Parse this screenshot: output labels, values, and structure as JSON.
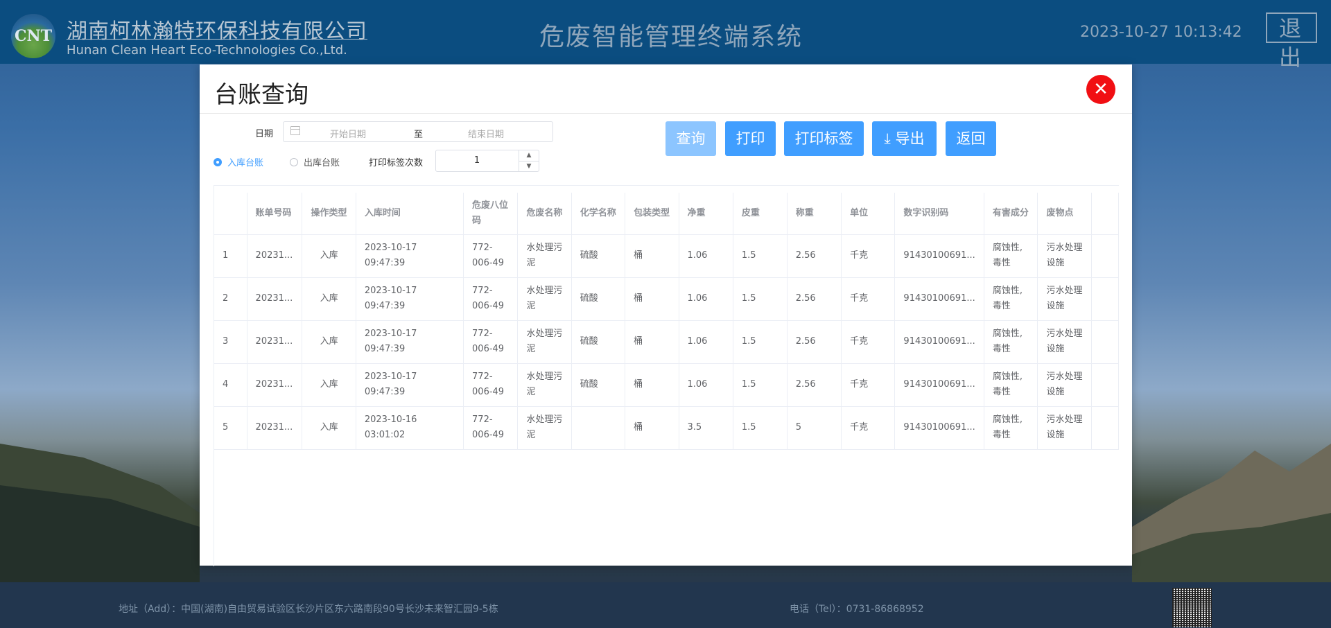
{
  "header": {
    "logo_text": "CNT",
    "company_cn": "湖南柯林瀚特环保科技有限公司",
    "company_en": "Hunan Clean Heart Eco-Technologies Co.,Ltd.",
    "system_title": "危废智能管理终端系统",
    "datetime": "2023-10-27 10:13:42",
    "logout_label": "退出"
  },
  "modal": {
    "title": "台账查询",
    "close_symbol": "✕",
    "filters": {
      "date_label": "日期",
      "start_placeholder": "开始日期",
      "range_separator": "至",
      "end_placeholder": "结束日期",
      "radio_in": "入库台账",
      "radio_out": "出库台账",
      "print_count_label": "打印标签次数",
      "print_count_value": "1"
    },
    "buttons": {
      "query": "查询",
      "print": "打印",
      "print_label": "打印标签",
      "export": "⤓ 导出",
      "back": "返回"
    },
    "table": {
      "headers": [
        "",
        "账单号码",
        "操作类型",
        "入库时间",
        "危废八位码",
        "危废名称",
        "化学名称",
        "包装类型",
        "净重",
        "皮重",
        "称重",
        "单位",
        "数字识别码",
        "有害成分",
        "废物点"
      ],
      "rows": [
        [
          "1",
          "20231...",
          "入库",
          "2023-10-17 09:47:39",
          "772-006-49",
          "水处理污泥",
          "硫酸",
          "桶",
          "1.06",
          "1.5",
          "2.56",
          "千克",
          "91430100691...",
          "腐蚀性,毒性",
          "污水处理设施"
        ],
        [
          "2",
          "20231...",
          "入库",
          "2023-10-17 09:47:39",
          "772-006-49",
          "水处理污泥",
          "硫酸",
          "桶",
          "1.06",
          "1.5",
          "2.56",
          "千克",
          "91430100691...",
          "腐蚀性,毒性",
          "污水处理设施"
        ],
        [
          "3",
          "20231...",
          "入库",
          "2023-10-17 09:47:39",
          "772-006-49",
          "水处理污泥",
          "硫酸",
          "桶",
          "1.06",
          "1.5",
          "2.56",
          "千克",
          "91430100691...",
          "腐蚀性,毒性",
          "污水处理设施"
        ],
        [
          "4",
          "20231...",
          "入库",
          "2023-10-17 09:47:39",
          "772-006-49",
          "水处理污泥",
          "硫酸",
          "桶",
          "1.06",
          "1.5",
          "2.56",
          "千克",
          "91430100691...",
          "腐蚀性,毒性",
          "污水处理设施"
        ],
        [
          "5",
          "20231...",
          "入库",
          "2023-10-16 03:01:02",
          "772-006-49",
          "水处理污泥",
          "",
          "桶",
          "3.5",
          "1.5",
          "5",
          "千克",
          "91430100691...",
          "腐蚀性,毒性",
          "污水处理设施"
        ]
      ]
    }
  },
  "footer": {
    "address": "地址（Add）：中国(湖南)自由贸易试验区长沙片区东六路南段90号长沙未来智汇园9-5栋",
    "phone": "电话（Tel）：0731-86868952"
  }
}
